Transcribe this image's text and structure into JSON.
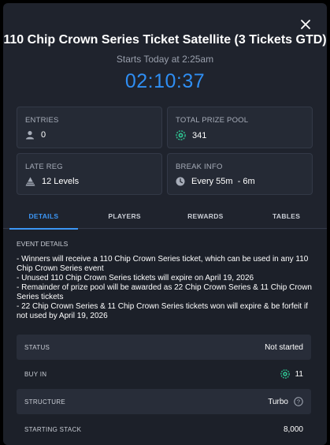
{
  "header": {
    "title": "110 Chip Crown Series Ticket Satellite (3 Tickets GTD)",
    "subtitle": "Starts Today at 2:25am",
    "countdown": "02:10:37"
  },
  "cards": {
    "entries": {
      "label": "ENTRIES",
      "value": "0",
      "icon": "person-icon"
    },
    "prize_pool": {
      "label": "TOTAL PRIZE POOL",
      "value": "341",
      "icon": "chip-icon"
    },
    "late_reg": {
      "label": "LATE REG",
      "value": "12 Levels",
      "icon": "pyramid-icon"
    },
    "break_info": {
      "label": "BREAK INFO",
      "value": "Every 55m  - 6m",
      "icon": "clock-icon"
    }
  },
  "tabs": [
    {
      "label": "DETAILS",
      "active": true
    },
    {
      "label": "PLAYERS",
      "active": false
    },
    {
      "label": "REWARDS",
      "active": false
    },
    {
      "label": "TABLES",
      "active": false
    }
  ],
  "event_details": {
    "title": "EVENT DETAILS",
    "lines": [
      "- Winners will receive a 110 Chip Crown Series ticket, which can be used in any 110 Chip Crown Series event",
      "- Unused 110 Chip Crown Series tickets will expire on April 19, 2026",
      "- Remainder of prize pool will be awarded as 22 Chip Crown Series & 11 Chip Crown Series tickets",
      "- 22 Chip Crown Series & 11 Chip Crown Series tickets won will expire & be forfeit if not used by April 19, 2026"
    ]
  },
  "info_rows": [
    {
      "label": "STATUS",
      "value": "Not started"
    },
    {
      "label": "BUY IN",
      "value": "11",
      "icon": "chip-icon"
    },
    {
      "label": "STRUCTURE",
      "value": "Turbo",
      "icon": "help-icon"
    },
    {
      "label": "STARTING STACK",
      "value": "8,000"
    }
  ],
  "colors": {
    "accent": "#2f8ef3",
    "chip": "#2fbf8f",
    "background": "#1f232d"
  }
}
